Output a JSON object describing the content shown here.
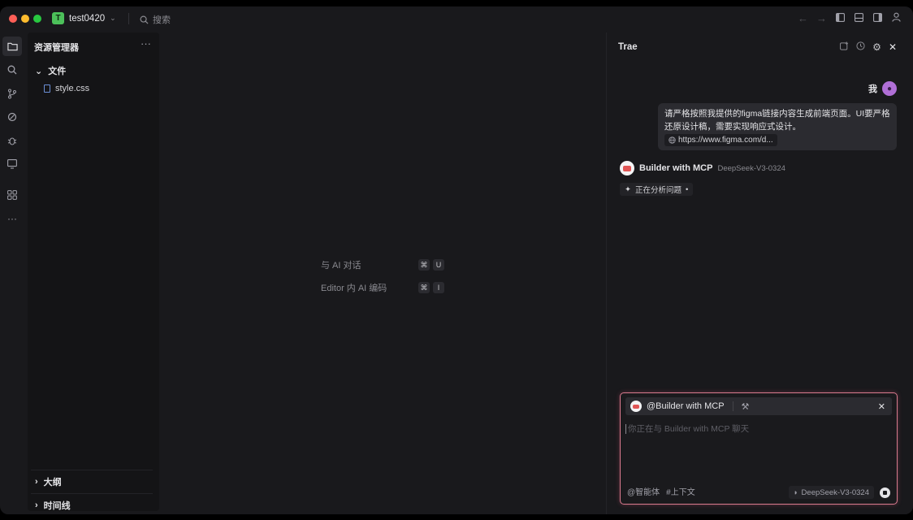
{
  "titlebar": {
    "project_badge": "T",
    "project_name": "test0420",
    "search_label": "搜索",
    "traffic_colors": [
      "#ff5f57",
      "#febc2e",
      "#28c840"
    ]
  },
  "explorer": {
    "title": "资源管理器",
    "folder_label": "文件",
    "files": [
      "style.css"
    ],
    "outline_label": "大纲",
    "timeline_label": "时间线"
  },
  "editor": {
    "hints": [
      {
        "label": "与 AI 对话",
        "keys": [
          "⌘",
          "U"
        ]
      },
      {
        "label": "Editor 内 AI 编码",
        "keys": [
          "⌘",
          "I"
        ]
      }
    ]
  },
  "chat": {
    "title": "Trae",
    "user_label": "我",
    "user_message": "请严格按照我提供的figma链接内容生成前端页面。UI要严格还原设计稿，需要实现响应式设计。",
    "link_text": "https://www.figma.com/d...",
    "bot_name": "Builder with MCP",
    "bot_model": "DeepSeek-V3-0324",
    "status_text": "正在分析问题",
    "composer": {
      "agent_label": "@Builder with MCP",
      "placeholder": "你正在与 Builder with MCP 聊天",
      "agents_label": "@智能体",
      "context_label": "#上下文",
      "model_label": "DeepSeek-V3-0324"
    }
  }
}
